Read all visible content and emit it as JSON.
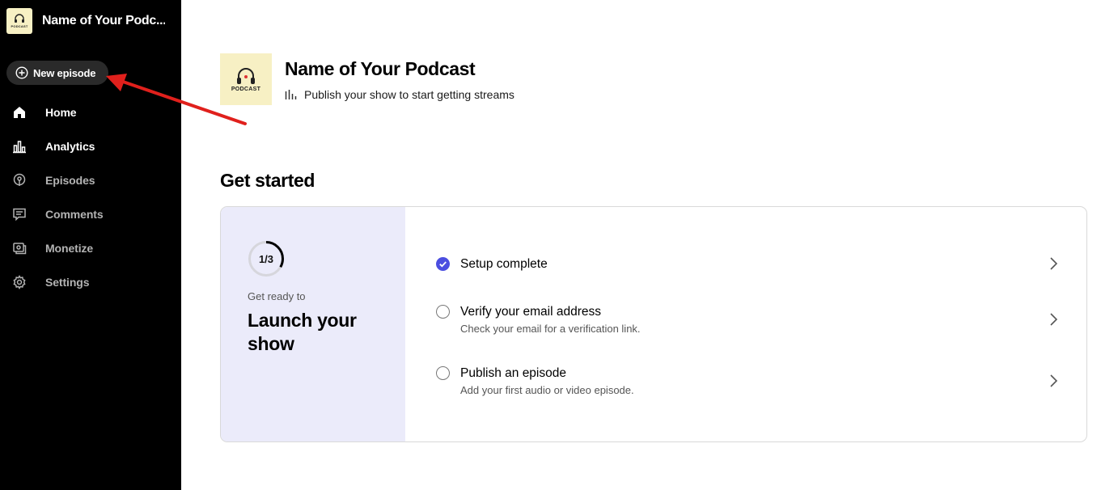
{
  "sidebar": {
    "brand": {
      "name": "Name of Your Podc...",
      "logo_caption": "PODCAST"
    },
    "new_episode_label": "New episode",
    "items": [
      {
        "label": "Home",
        "icon": "home-icon",
        "active": true
      },
      {
        "label": "Analytics",
        "icon": "analytics-icon",
        "active": true
      },
      {
        "label": "Episodes",
        "icon": "episodes-icon",
        "active": false
      },
      {
        "label": "Comments",
        "icon": "comments-icon",
        "active": false
      },
      {
        "label": "Monetize",
        "icon": "monetize-icon",
        "active": false
      },
      {
        "label": "Settings",
        "icon": "settings-icon",
        "active": false
      }
    ]
  },
  "header": {
    "art_caption": "PODCAST",
    "title": "Name of Your Podcast",
    "status": "Publish your show to start getting streams"
  },
  "main": {
    "section_title": "Get started",
    "checklist": {
      "progress_label": "1/3",
      "progress_fraction": 0.333,
      "kicker": "Get ready to",
      "headline": "Launch your show",
      "steps": [
        {
          "title": "Setup complete",
          "desc": "",
          "done": true
        },
        {
          "title": "Verify your email address",
          "desc": "Check your email for a verification link.",
          "done": false
        },
        {
          "title": "Publish an episode",
          "desc": "Add your first audio or video episode.",
          "done": false
        }
      ]
    }
  },
  "colors": {
    "sidebar_bg": "#000000",
    "accent": "#4b4ee0",
    "card_left_bg": "#ebebfa",
    "annotation_arrow": "#e0201c"
  }
}
